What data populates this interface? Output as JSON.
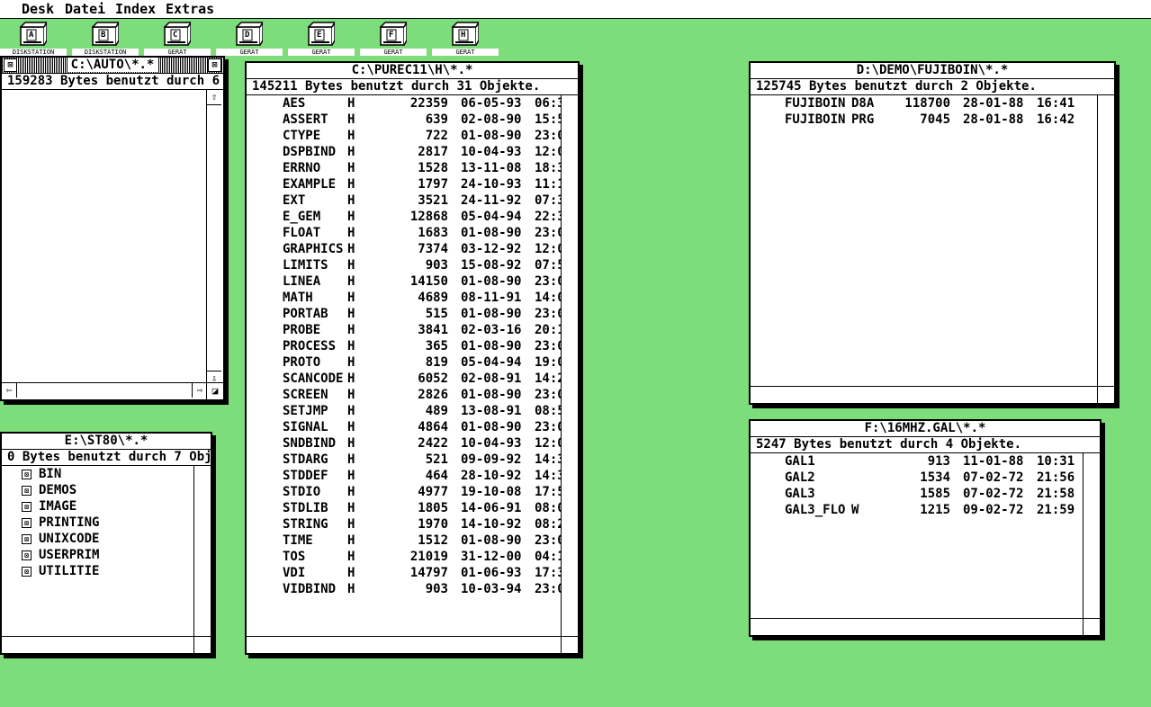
{
  "menu": [
    "Desk",
    "Datei",
    "Index",
    "Extras"
  ],
  "desktop_icons": [
    {
      "label": "DISKSTATION",
      "letter": "A"
    },
    {
      "label": "DISKSTATION",
      "letter": "B"
    },
    {
      "label": "GERÄT",
      "letter": "C"
    },
    {
      "label": "GERÄT",
      "letter": "D"
    },
    {
      "label": "GERÄT",
      "letter": "E"
    },
    {
      "label": "GERÄT",
      "letter": "F"
    },
    {
      "label": "GERÄT",
      "letter": "H"
    }
  ],
  "windows": {
    "auto": {
      "title": "C:\\AUTO\\*.*",
      "info": "159283 Bytes benutzt durch 6",
      "close": "⊠",
      "full": "⊠"
    },
    "st80": {
      "title": "E:\\ST80\\*.*",
      "info": "0 Bytes benutzt durch 7 Objekte.",
      "folders": [
        "BIN",
        "DEMOS",
        "IMAGE",
        "PRINTING",
        "UNIXCODE",
        "USERPRIM",
        "UTILITIE"
      ]
    },
    "purec": {
      "title": "C:\\PUREC11\\H\\*.*",
      "info": "145211 Bytes benutzt durch 31 Objekte.",
      "files": [
        [
          "AES",
          "H",
          "22359",
          "06-05-93",
          "06:3"
        ],
        [
          "ASSERT",
          "H",
          "639",
          "02-08-90",
          "15:5"
        ],
        [
          "CTYPE",
          "H",
          "722",
          "01-08-90",
          "23:0"
        ],
        [
          "DSPBIND",
          "H",
          "2817",
          "10-04-93",
          "12:0"
        ],
        [
          "ERRNO",
          "H",
          "1528",
          "13-11-08",
          "18:3"
        ],
        [
          "EXAMPLE",
          "H",
          "1797",
          "24-10-93",
          "11:1"
        ],
        [
          "EXT",
          "H",
          "3521",
          "24-11-92",
          "07:3"
        ],
        [
          "E_GEM",
          "H",
          "12868",
          "05-04-94",
          "22:3"
        ],
        [
          "FLOAT",
          "H",
          "1683",
          "01-08-90",
          "23:0"
        ],
        [
          "GRAPHICS",
          "H",
          "7374",
          "03-12-92",
          "12:0"
        ],
        [
          "LIMITS",
          "H",
          "903",
          "15-08-92",
          "07:5"
        ],
        [
          "LINEA",
          "H",
          "14150",
          "01-08-90",
          "23:0"
        ],
        [
          "MATH",
          "H",
          "4689",
          "08-11-91",
          "14:0"
        ],
        [
          "PORTAB",
          "H",
          "515",
          "01-08-90",
          "23:0"
        ],
        [
          "PROBE",
          "H",
          "3841",
          "02-03-16",
          "20:1"
        ],
        [
          "PROCESS",
          "H",
          "365",
          "01-08-90",
          "23:0"
        ],
        [
          "PROTO",
          "H",
          "819",
          "05-04-94",
          "19:0"
        ],
        [
          "SCANCODE",
          "H",
          "6052",
          "02-08-91",
          "14:2"
        ],
        [
          "SCREEN",
          "H",
          "2826",
          "01-08-90",
          "23:0"
        ],
        [
          "SETJMP",
          "H",
          "489",
          "13-08-91",
          "08:5"
        ],
        [
          "SIGNAL",
          "H",
          "4864",
          "01-08-90",
          "23:0"
        ],
        [
          "SNDBIND",
          "H",
          "2422",
          "10-04-93",
          "12:0"
        ],
        [
          "STDARG",
          "H",
          "521",
          "09-09-92",
          "14:3"
        ],
        [
          "STDDEF",
          "H",
          "464",
          "28-10-92",
          "14:3"
        ],
        [
          "STDIO",
          "H",
          "4977",
          "19-10-08",
          "17:5"
        ],
        [
          "STDLIB",
          "H",
          "1805",
          "14-06-91",
          "08:0"
        ],
        [
          "STRING",
          "H",
          "1970",
          "14-10-92",
          "08:2"
        ],
        [
          "TIME",
          "H",
          "1512",
          "01-08-90",
          "23:0"
        ],
        [
          "TOS",
          "H",
          "21019",
          "31-12-00",
          "04:1"
        ],
        [
          "VDI",
          "H",
          "14797",
          "01-06-93",
          "17:3"
        ],
        [
          "VIDBIND",
          "H",
          "903",
          "10-03-94",
          "23:0"
        ]
      ]
    },
    "fuji": {
      "title": "D:\\DEMO\\FUJIBOIN\\*.*",
      "info": "125745 Bytes benutzt durch 2 Objekte.",
      "files": [
        [
          "FUJIBOIN",
          "D8A",
          "118700",
          "28-01-88",
          "16:41"
        ],
        [
          "FUJIBOIN",
          "PRG",
          "7045",
          "28-01-88",
          "16:42"
        ]
      ]
    },
    "gal": {
      "title": "F:\\16MHZ.GAL\\*.*",
      "info": "5247 Bytes benutzt durch 4 Objekte.",
      "files": [
        [
          "GAL1",
          "",
          "913",
          "11-01-88",
          "10:31"
        ],
        [
          "GAL2",
          "",
          "1534",
          "07-02-72",
          "21:56"
        ],
        [
          "GAL3",
          "",
          "1585",
          "07-02-72",
          "21:58"
        ],
        [
          "GAL3_FLO",
          "W",
          "1215",
          "09-02-72",
          "21:59"
        ]
      ]
    }
  },
  "arrows": {
    "up": "⇧",
    "down": "⇩",
    "left": "⇦",
    "right": "⇨",
    "size": "◪"
  }
}
